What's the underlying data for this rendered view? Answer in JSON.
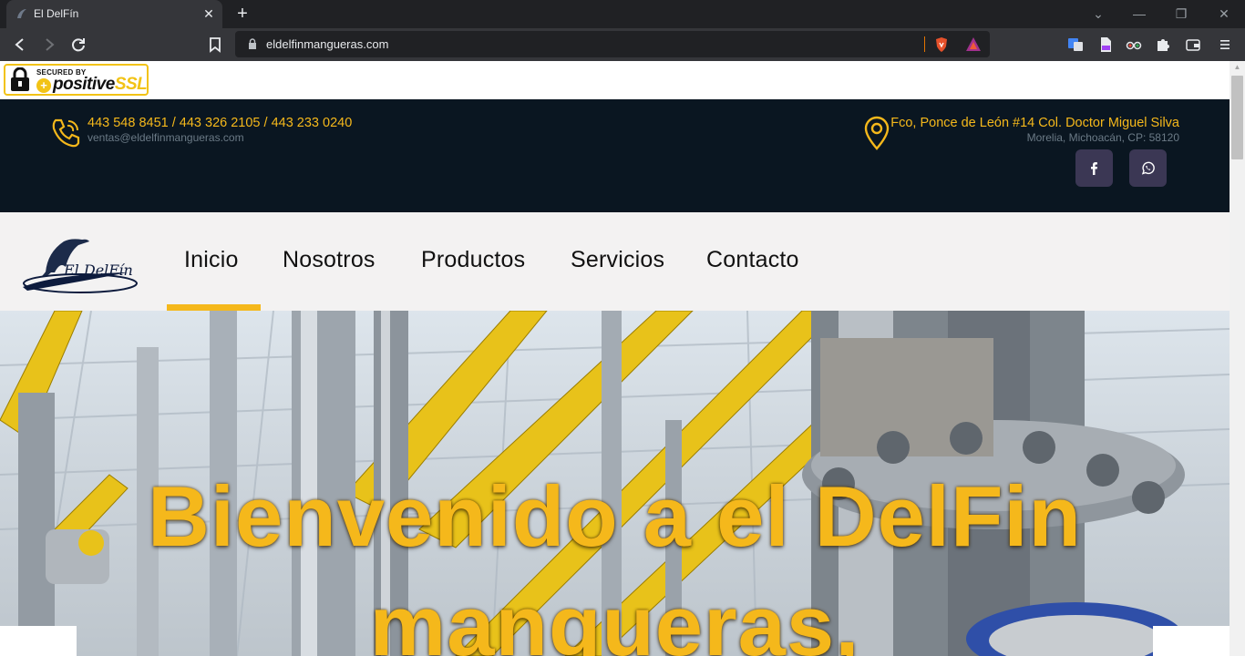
{
  "browser": {
    "tab_title": "El DelFín",
    "url": "eldelfinmangueras.com",
    "newtab_label": "+",
    "tab_close_label": "✕",
    "minimize_label": "—",
    "restore_label": "❐",
    "close_label": "✕",
    "chevron_label": "⌄"
  },
  "ssl_badge": {
    "line1": "SECURED BY",
    "brand_a": "positive",
    "brand_b": "SSL"
  },
  "contact": {
    "phones": "443 548 8451 / 443 326 2105 / 443 233 0240",
    "email": "ventas@eldelfinmangueras.com",
    "address": "Fco, Ponce de León #14 Col. Doctor Miguel Silva",
    "city": "Morelia, Michoacán, CP: 58120"
  },
  "social": [
    "facebook-icon",
    "whatsapp-icon"
  ],
  "logo": {
    "text": "El DelFín"
  },
  "nav": {
    "items": [
      "Inicio",
      "Nosotros",
      "Productos",
      "Servicios",
      "Contacto"
    ],
    "active": "Inicio"
  },
  "hero": {
    "line1": "Bienvenido a el DelFin",
    "line2": "mangueras,"
  },
  "colors": {
    "accent": "#f5b81b",
    "topbar": "#0a1621",
    "navbar": "#f3f2f2",
    "social_button": "#3b3754"
  }
}
